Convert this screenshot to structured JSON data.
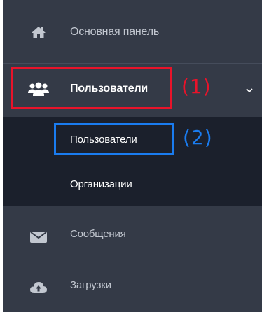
{
  "sidebar": {
    "items": [
      {
        "label": "Основная панель",
        "icon": "home-icon"
      },
      {
        "label": "Пользователи",
        "icon": "users-icon",
        "expanded": true
      },
      {
        "label": "Сообщения",
        "icon": "envelope-icon"
      },
      {
        "label": "Загрузки",
        "icon": "cloud-upload-icon"
      }
    ],
    "submenu": [
      {
        "label": "Пользователи"
      },
      {
        "label": "Организации"
      }
    ]
  },
  "annotations": {
    "tag_1": "(1)",
    "tag_2": "(2)",
    "color_1": "#e8132a",
    "color_2": "#1a7cf0"
  },
  "colors": {
    "sidebar_bg": "#343a47",
    "submenu_bg": "#1b202c",
    "text_muted": "#c2c7d0",
    "text_active": "#ffffff"
  }
}
